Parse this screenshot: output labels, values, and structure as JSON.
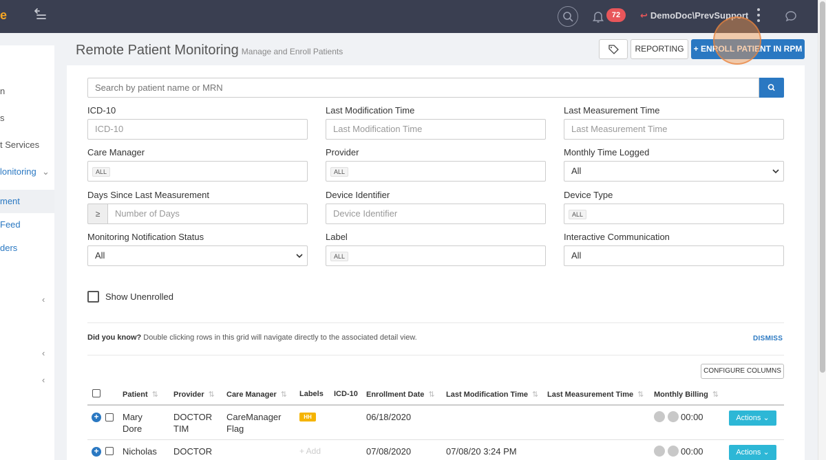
{
  "topbar": {
    "notification_count": "72",
    "user_name": "DemoDoc\\PrevSupport"
  },
  "sidebar": {
    "items": [
      {
        "label": "n"
      },
      {
        "label": "s"
      },
      {
        "label": "t Services"
      },
      {
        "label": "lonitoring"
      },
      {
        "label": "ment"
      },
      {
        "label": "Feed"
      },
      {
        "label": "ders"
      }
    ]
  },
  "header": {
    "title": "Remote Patient Monitoring",
    "subtitle": "Manage and Enroll Patients",
    "reporting_label": "REPORTING",
    "enroll_label": "+ ENROLL PATIENT IN RPM"
  },
  "search": {
    "placeholder": "Search by patient name or MRN"
  },
  "filters": {
    "icd10": {
      "label": "ICD-10",
      "placeholder": "ICD-10"
    },
    "last_mod": {
      "label": "Last Modification Time",
      "placeholder": "Last Modification Time"
    },
    "last_meas": {
      "label": "Last Measurement Time",
      "placeholder": "Last Measurement Time"
    },
    "care_manager": {
      "label": "Care Manager",
      "chip": "ALL"
    },
    "provider": {
      "label": "Provider",
      "chip": "ALL"
    },
    "monthly_time": {
      "label": "Monthly Time Logged",
      "value": "All"
    },
    "days_since": {
      "label": "Days Since Last Measurement",
      "addon": "≥",
      "placeholder": "Number of Days"
    },
    "device_id": {
      "label": "Device Identifier",
      "placeholder": "Device Identifier"
    },
    "device_type": {
      "label": "Device Type",
      "chip": "ALL"
    },
    "notif_status": {
      "label": "Monitoring Notification Status",
      "value": "All"
    },
    "label": {
      "label": "Label",
      "chip": "ALL"
    },
    "interactive": {
      "label": "Interactive Communication",
      "value": "All"
    }
  },
  "show_unenrolled": "Show Unenrolled",
  "tip": {
    "bold": "Did you know?",
    "text": "Double clicking rows in this grid will navigate directly to the associated detail view.",
    "dismiss": "DISMISS"
  },
  "configure_columns": "CONFIGURE COLUMNS",
  "table": {
    "headers": [
      "Patient",
      "Provider",
      "Care Manager",
      "Labels",
      "ICD-10",
      "Enrollment Date",
      "Last Modification Time",
      "Last Measurement Time",
      "Monthly Billing"
    ],
    "rows": [
      {
        "patient_first": "Mary",
        "patient_last": "Dore",
        "provider_1": "DOCTOR",
        "provider_2": "TIM",
        "cm_1": "CareManager",
        "cm_2": "Flag",
        "label": "HH",
        "enrollment": "06/18/2020",
        "last_mod": "",
        "billing": "00:00",
        "actions": "Actions"
      },
      {
        "patient_first": "Nicholas",
        "provider_1": "DOCTOR",
        "label": "+ Add",
        "enrollment": "07/08/2020",
        "last_mod": "07/08/20 3:24 PM",
        "billing": "00:00",
        "actions": "Actions"
      }
    ]
  },
  "colors": {
    "topbar": "#3a3f51",
    "primary": "#2a78c2",
    "badge": "#e8565a",
    "actions": "#2db7d6",
    "label_hh": "#f5b400"
  }
}
